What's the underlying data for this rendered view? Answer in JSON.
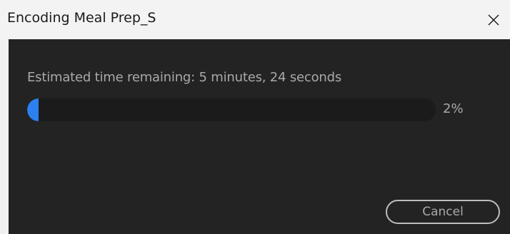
{
  "window": {
    "title": "Encoding Meal Prep_S",
    "close_icon": "close-icon"
  },
  "progress": {
    "status_text": "Estimated time remaining: 5 minutes, 24 seconds",
    "percent_label": "2%",
    "percent_value": 2,
    "fill_color": "#2c80f0"
  },
  "actions": {
    "cancel_label": "Cancel"
  }
}
